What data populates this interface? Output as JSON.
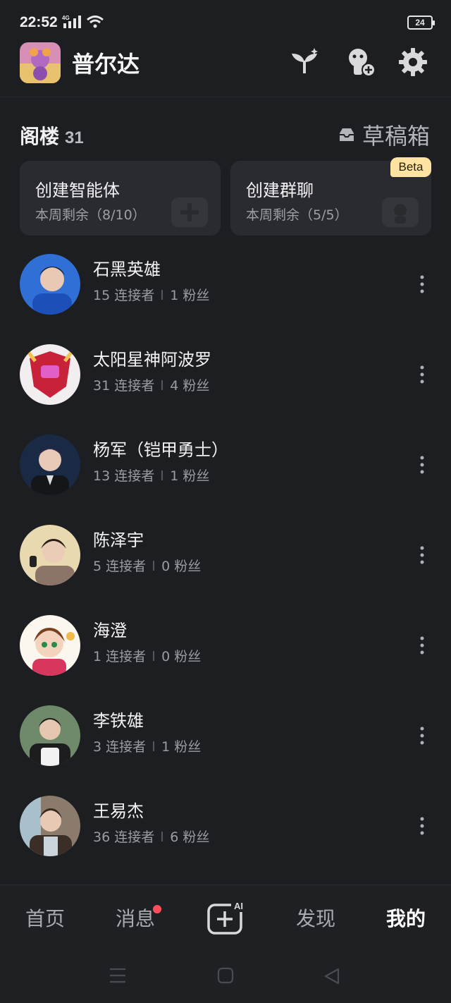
{
  "status_bar": {
    "time": "22:52",
    "network": "4G",
    "battery": "24"
  },
  "header": {
    "username": "普尔达"
  },
  "section": {
    "title": "阁楼",
    "count": "31",
    "drafts_label": "草稿箱"
  },
  "cards": [
    {
      "title": "创建智能体",
      "subtitle": "本周剩余（8/10）"
    },
    {
      "title": "创建群聊",
      "subtitle": "本周剩余（5/5）",
      "badge": "Beta"
    }
  ],
  "agents": [
    {
      "name": "石黑英雄",
      "connectors": "15 连接者",
      "fans": "1 粉丝"
    },
    {
      "name": "太阳星神阿波罗",
      "connectors": "31 连接者",
      "fans": "4 粉丝"
    },
    {
      "name": "杨军（铠甲勇士）",
      "connectors": "13 连接者",
      "fans": "1 粉丝"
    },
    {
      "name": "陈泽宇",
      "connectors": "5 连接者",
      "fans": "0 粉丝"
    },
    {
      "name": "海澄",
      "connectors": "1 连接者",
      "fans": "0 粉丝"
    },
    {
      "name": "李铁雄",
      "connectors": "3 连接者",
      "fans": "1 粉丝"
    },
    {
      "name": "王易杰",
      "connectors": "36 连接者",
      "fans": "6 粉丝"
    }
  ],
  "bottom_nav": {
    "home": "首页",
    "messages": "消息",
    "create_ai_badge": "AI",
    "discover": "发现",
    "mine": "我的"
  },
  "colors": {
    "background": "#1d1e22",
    "card": "#2a2b30",
    "beta": "#ffe3a1",
    "notify_dot": "#ff4d5a"
  }
}
